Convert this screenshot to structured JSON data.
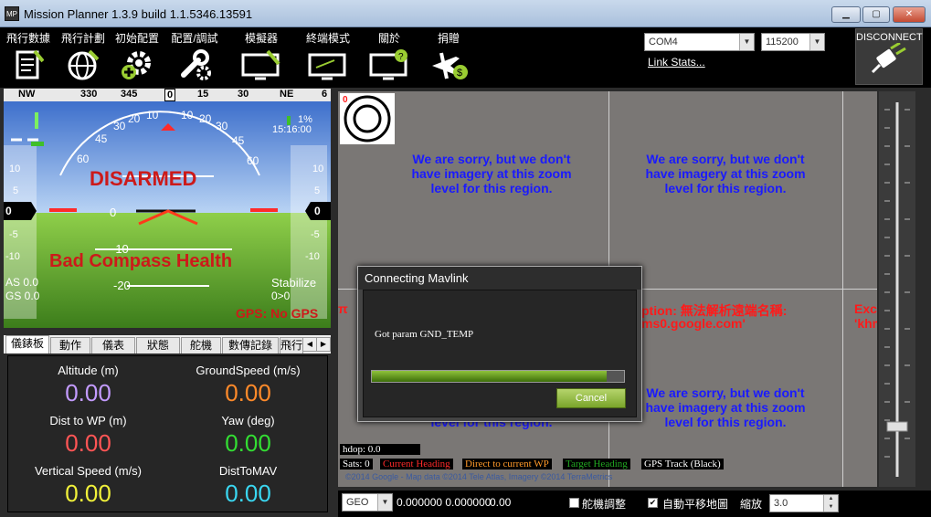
{
  "window": {
    "title": "Mission Planner 1.3.9 build 1.1.5346.13591",
    "app_icon_text": "MP"
  },
  "menu": [
    {
      "label": "飛行數據",
      "icon": "flight-data-icon"
    },
    {
      "label": "飛行計劃",
      "icon": "flight-plan-icon"
    },
    {
      "label": "初始配置",
      "icon": "initial-setup-icon"
    },
    {
      "label": "配置/調試",
      "icon": "config-tuning-icon"
    },
    {
      "label": "模擬器",
      "icon": "simulation-icon"
    },
    {
      "label": "終端模式",
      "icon": "terminal-icon"
    },
    {
      "label": "關於",
      "icon": "help-icon"
    },
    {
      "label": "捐贈",
      "icon": "donate-icon"
    }
  ],
  "connection": {
    "port": "COM4",
    "baud": "115200",
    "link_stats": "Link Stats...",
    "disconnect_label": "DISCONNECT"
  },
  "hud": {
    "heading_ticks": [
      "NW",
      "330",
      "345",
      "0",
      "15",
      "30",
      "NE",
      "6"
    ],
    "armed_status": "DISARMED",
    "warning": "Bad Compass Health",
    "airspeed": "AS 0.0",
    "groundspeed": "GS 0.0",
    "mode": "Stabilize",
    "wp_info": "0>0",
    "gps_status": "GPS: No GPS",
    "battery_percent": "1%",
    "clock": "15:16:00",
    "pitch_labels": [
      "0",
      "-10",
      "-20",
      "10",
      "20"
    ],
    "roll_labels": [
      "10",
      "20",
      "30",
      "45",
      "60"
    ],
    "speed_tape": [
      "10",
      "5",
      "0",
      "-5",
      "-10"
    ],
    "alt_tape": [
      "10",
      "5",
      "0",
      "-5",
      "-10"
    ]
  },
  "tabs": [
    "儀錶板",
    "動作",
    "儀表",
    "狀態",
    "舵機",
    "數傳記錄",
    "飛行"
  ],
  "active_tab": "儀錶板",
  "quick": [
    {
      "label": "Altitude (m)",
      "value": "0.00",
      "color": "#c39bff"
    },
    {
      "label": "GroundSpeed (m/s)",
      "value": "0.00",
      "color": "#ff8a2a"
    },
    {
      "label": "Dist to WP (m)",
      "value": "0.00",
      "color": "#ff5555"
    },
    {
      "label": "Yaw (deg)",
      "value": "0.00",
      "color": "#33dd33"
    },
    {
      "label": "Vertical Speed (m/s)",
      "value": "0.00",
      "color": "#f0f03a"
    },
    {
      "label": "DistToMAV",
      "value": "0.00",
      "color": "#3ad6f0"
    }
  ],
  "map": {
    "sorry_text": "We are sorry, but we don't have imagery at this zoom level for this region.",
    "exception_left": "ption:  無法解析遠端名稱:",
    "exception_left2": "ms0.google.com'",
    "exception_right": "Exc",
    "exception_right2": "'khm",
    "exception_edge": "π",
    "compass_marker": "0",
    "hdop": "hdop: 0.0",
    "sats": "Sats: 0",
    "legend": [
      {
        "label": "Current Heading",
        "color": "#ff2a2a"
      },
      {
        "label": "Direct to current WP",
        "color": "#ff9a2a"
      },
      {
        "label": "Target Heading",
        "color": "#22aa22"
      },
      {
        "label": "GPS Track (Black)",
        "color": "#ffffff"
      }
    ],
    "copyright": "©2014 Google - Map data ©2014 Tele Atlas, Imagery ©2014 TerraMetrics"
  },
  "bottom": {
    "map_type": "GEO",
    "coords": "0.000000 0.000000",
    "alt": "0.00",
    "chk1_label": "舵機調整",
    "chk2_label": "自動平移地圖",
    "zoom_label": "縮放",
    "zoom_value": "3.0"
  },
  "dialog": {
    "title": "Connecting Mavlink",
    "message": "Got param GND_TEMP",
    "progress": 0.93,
    "cancel": "Cancel"
  }
}
